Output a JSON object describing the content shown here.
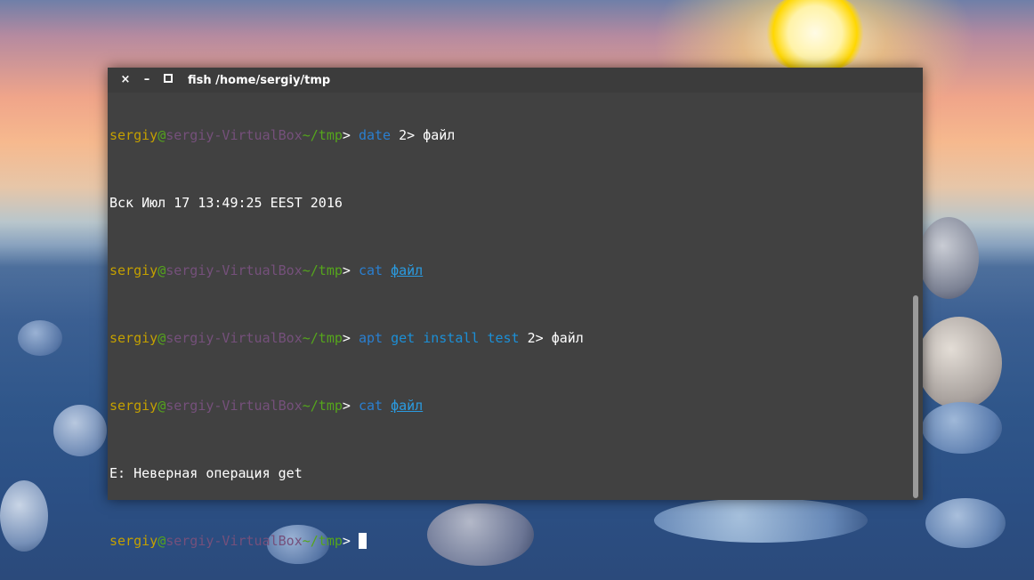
{
  "window": {
    "app": "fish",
    "path": "/home/sergiy/tmp"
  },
  "window_controls": {
    "close": "×",
    "minimize": "–",
    "maximize": ""
  },
  "prompt": {
    "user": "sergiy",
    "at": "@",
    "host": "sergiy-VirtualBox",
    "cwd": "~/tmp",
    "symbol": "> "
  },
  "terminal": {
    "lines": [
      {
        "cmd": "date",
        "args": " 2> файл"
      },
      {
        "output": "Вск Июл 17 13:49:25 EEST 2016"
      },
      {
        "cmd": "cat",
        "file": "файл"
      },
      {
        "cmd": "apt",
        "sub1": "get",
        "sub2": "install",
        "sub3": "test",
        "args": " 2> файл"
      },
      {
        "cmd": "cat",
        "file": "файл"
      },
      {
        "output": "E: Неверная операция get"
      }
    ]
  },
  "colors": {
    "terminal_bg": "#414141",
    "titlebar_bg": "#3c3c3c",
    "user": "#c4a000",
    "host": "#75507b",
    "cwd": "#55a51c",
    "command": "#2a7fd0",
    "link": "#2a9be0"
  }
}
